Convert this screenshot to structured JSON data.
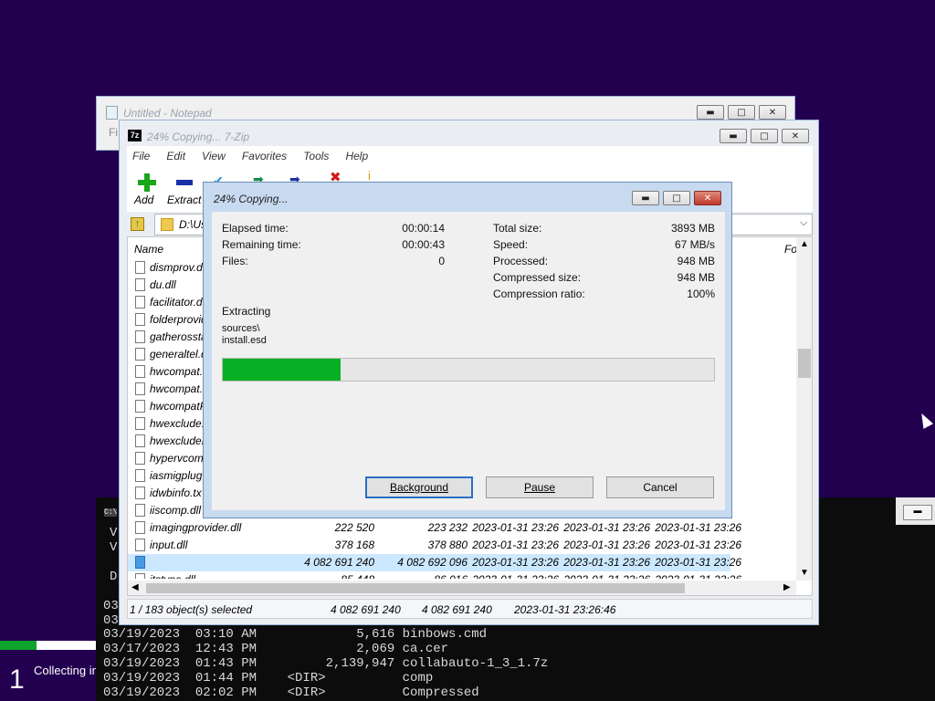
{
  "notepad": {
    "title": "Untitled - Notepad",
    "menu_fragment": "Fi"
  },
  "sevenzip": {
    "title": "24% Copying... 7-Zip",
    "app_icon": "7z",
    "menu": [
      "File",
      "Edit",
      "View",
      "Favorites",
      "Tools",
      "Help"
    ],
    "toolbar": {
      "add": "Add",
      "extract": "Extract"
    },
    "path": "D:\\Us",
    "columns": {
      "name": "Name",
      "right": "Fo"
    },
    "files": [
      {
        "name": "dismprov.dl"
      },
      {
        "name": "du.dll"
      },
      {
        "name": "facilitator.d"
      },
      {
        "name": "folderprovid"
      },
      {
        "name": "gatherossta"
      },
      {
        "name": "generaltel.d"
      },
      {
        "name": "hwcompat.d"
      },
      {
        "name": "hwcompat.t"
      },
      {
        "name": "hwcompatP"
      },
      {
        "name": "hwexclude.t"
      },
      {
        "name": "hwexcludeP"
      },
      {
        "name": "hypervcomp"
      },
      {
        "name": "iasmigplug"
      },
      {
        "name": "idwbinfo.tx"
      },
      {
        "name": "iiscomp.dll"
      },
      {
        "name": "imagingprovider.dll",
        "size": "222 520",
        "packed": "223 232",
        "modified": "2023-01-31 23:26",
        "created": "2023-01-31 23:26",
        "accessed": "2023-01-31 23:26"
      },
      {
        "name": "input.dll",
        "size": "378 168",
        "packed": "378 880",
        "modified": "2023-01-31 23:26",
        "created": "2023-01-31 23:26",
        "accessed": "2023-01-31 23:26"
      },
      {
        "name": "",
        "size": "4 082 691 240",
        "packed": "4 082 692 096",
        "modified": "2023-01-31 23:26",
        "created": "2023-01-31 23:26",
        "accessed": "2023-01-31 23:26"
      },
      {
        "name": "itstypa.dll",
        "size": "85 448",
        "packed": "86 016",
        "modified": "2023-01-31 23:26",
        "created": "2023-01-31 23:26",
        "accessed": "2023-01-31 23:26"
      }
    ],
    "status": {
      "selected": "1 / 183 object(s) selected",
      "size": "4 082 691 240",
      "packed": "4 082 691 240",
      "date": "2023-01-31 23:26:46"
    }
  },
  "progress_dialog": {
    "title": "24% Copying...",
    "elapsed_label": "Elapsed time:",
    "elapsed": "00:00:14",
    "remaining_label": "Remaining time:",
    "remaining": "00:00:43",
    "files_label": "Files:",
    "files": "0",
    "total_size_label": "Total size:",
    "total_size": "3893 MB",
    "speed_label": "Speed:",
    "speed": "67 MB/s",
    "processed_label": "Processed:",
    "processed": "948 MB",
    "compressed_size_label": "Compressed size:",
    "compressed_size": "948 MB",
    "ratio_label": "Compression ratio:",
    "ratio": "100%",
    "action": "Extracting",
    "file_line1": "sources\\",
    "file_line2": "install.esd",
    "progress": 0.24,
    "buttons": {
      "background": "Background",
      "pause": "Pause",
      "cancel": "Cancel"
    },
    "progress_color": "#06b025"
  },
  "console": {
    "left_fragments": [
      "C:\\",
      "V",
      "V",
      "D",
      "03",
      "03"
    ],
    "lines": [
      "03/19/2023  03:10 AM             5,616 binbows.cmd",
      "03/17/2023  12:43 PM             2,069 ca.cer",
      "03/19/2023  01:43 PM         2,139,947 collabauto-1_3_1.7z",
      "03/19/2023  01:44 PM    <DIR>          comp",
      "03/19/2023  02:02 PM    <DIR>          Compressed"
    ]
  },
  "setup": {
    "step": "1",
    "status": "Collecting in"
  }
}
